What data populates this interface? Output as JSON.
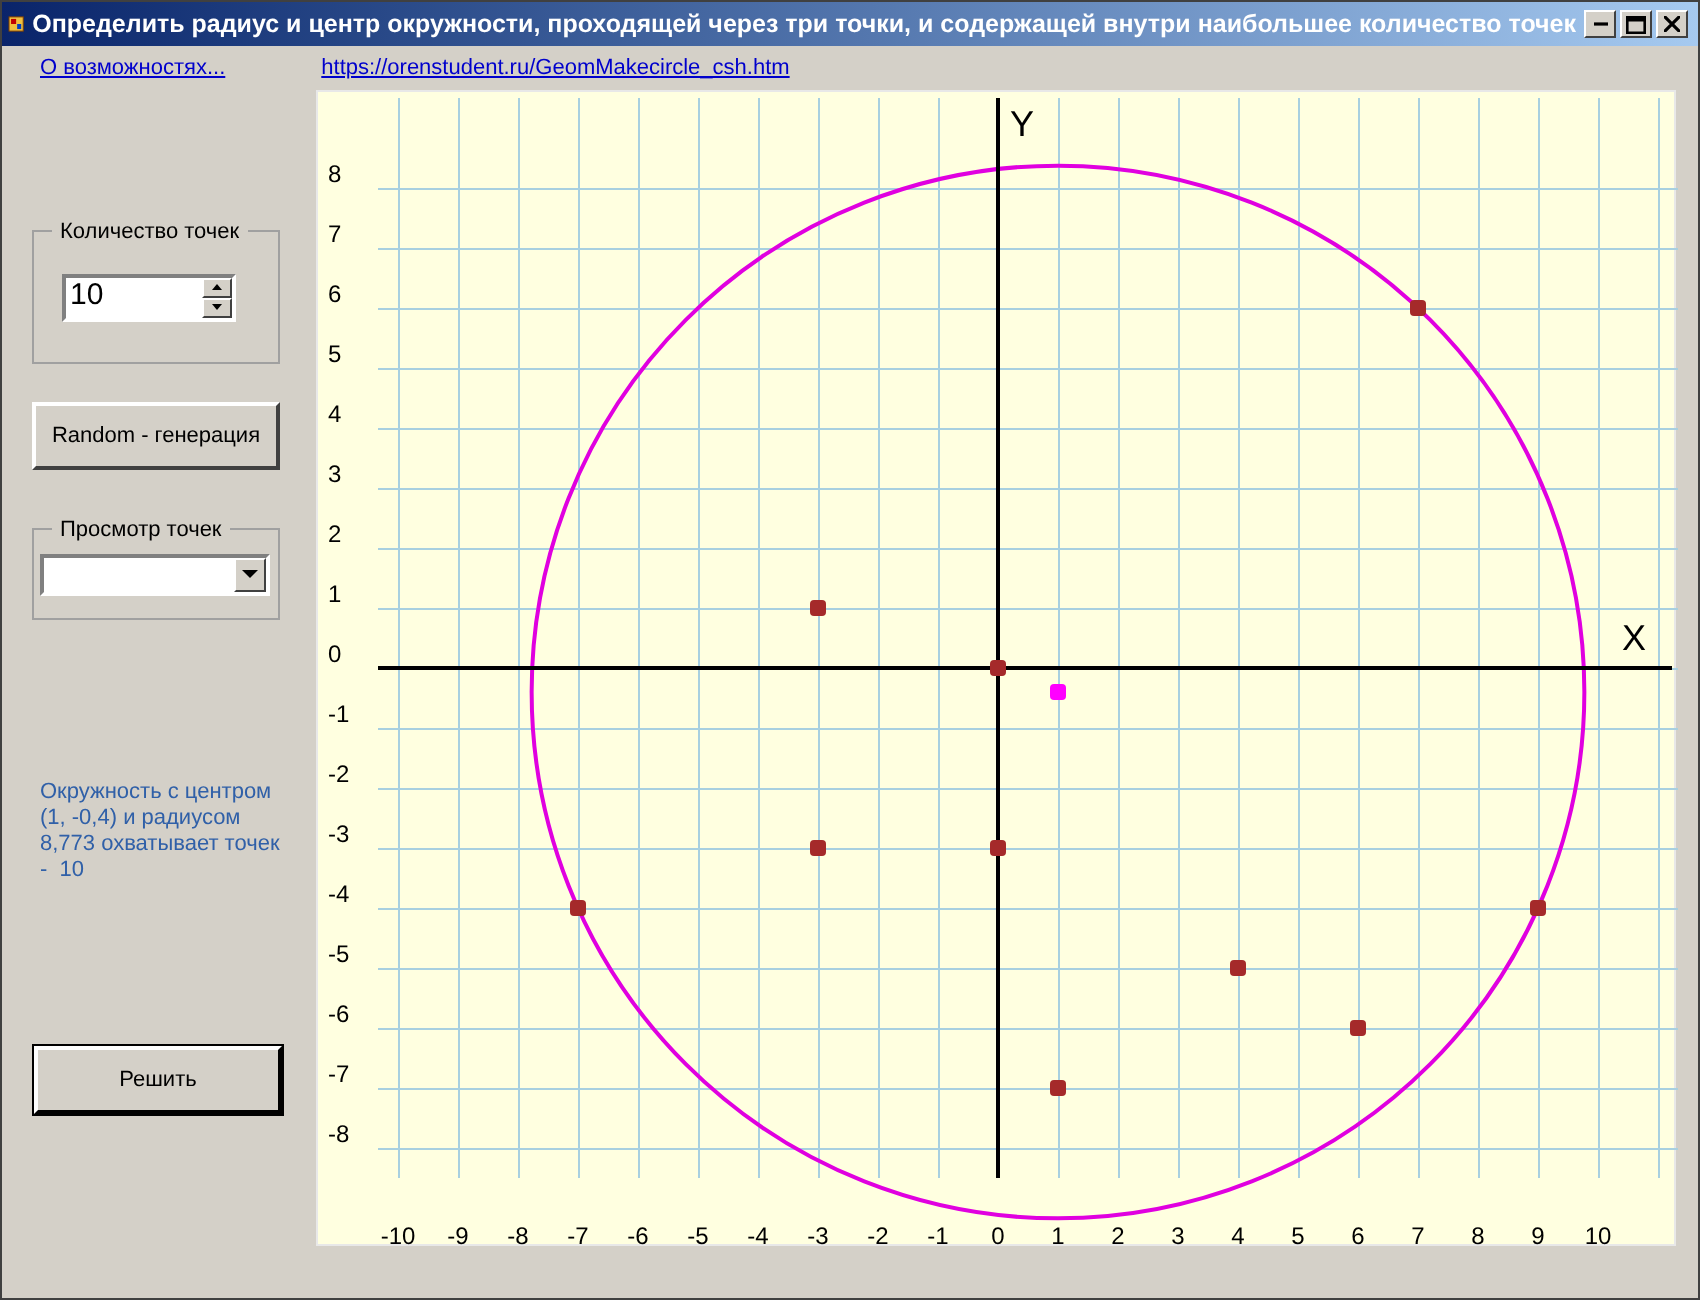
{
  "window": {
    "title": "Определить радиус и центр окружности, проходящей через три точки, и содержащей внутри наибольшее количество точек"
  },
  "links": [
    "О возможностях...",
    "https://orenstudent.ru/GeomMakecircle_csh.htm"
  ],
  "points_count": {
    "label": "Количество точек",
    "value": "10"
  },
  "random_button": "Random - генерация",
  "view_points": {
    "label": "Просмотр точек"
  },
  "result": "Окружность с центром (1, -0,4) и радиусом 8,773 охватывает точек   -  10",
  "solve_button": "Решить",
  "chart_data": {
    "type": "scatter",
    "xlabel": "X",
    "ylabel": "Y",
    "xlim": [
      -10,
      10
    ],
    "ylim": [
      -8.5,
      9.5
    ],
    "xticks": [
      -10,
      -9,
      -8,
      -7,
      -6,
      -5,
      -4,
      -3,
      -2,
      -1,
      0,
      1,
      2,
      3,
      4,
      5,
      6,
      7,
      8,
      9,
      10
    ],
    "yticks": [
      8,
      7,
      6,
      5,
      4,
      3,
      2,
      1,
      0,
      -1,
      -2,
      -3,
      -4,
      -5,
      -6,
      -7,
      -8
    ],
    "grid": true,
    "series": [
      {
        "color": "#a52a2a",
        "x": [
          0,
          -3,
          -3,
          0,
          -7,
          7,
          9,
          4,
          6,
          1
        ],
        "values": [
          0,
          1,
          -3,
          -3,
          -4,
          6,
          -4,
          -5,
          -6,
          -7
        ]
      },
      {
        "color": "#ff00ff",
        "x": [
          1
        ],
        "values": [
          -0.4
        ]
      }
    ]
  }
}
